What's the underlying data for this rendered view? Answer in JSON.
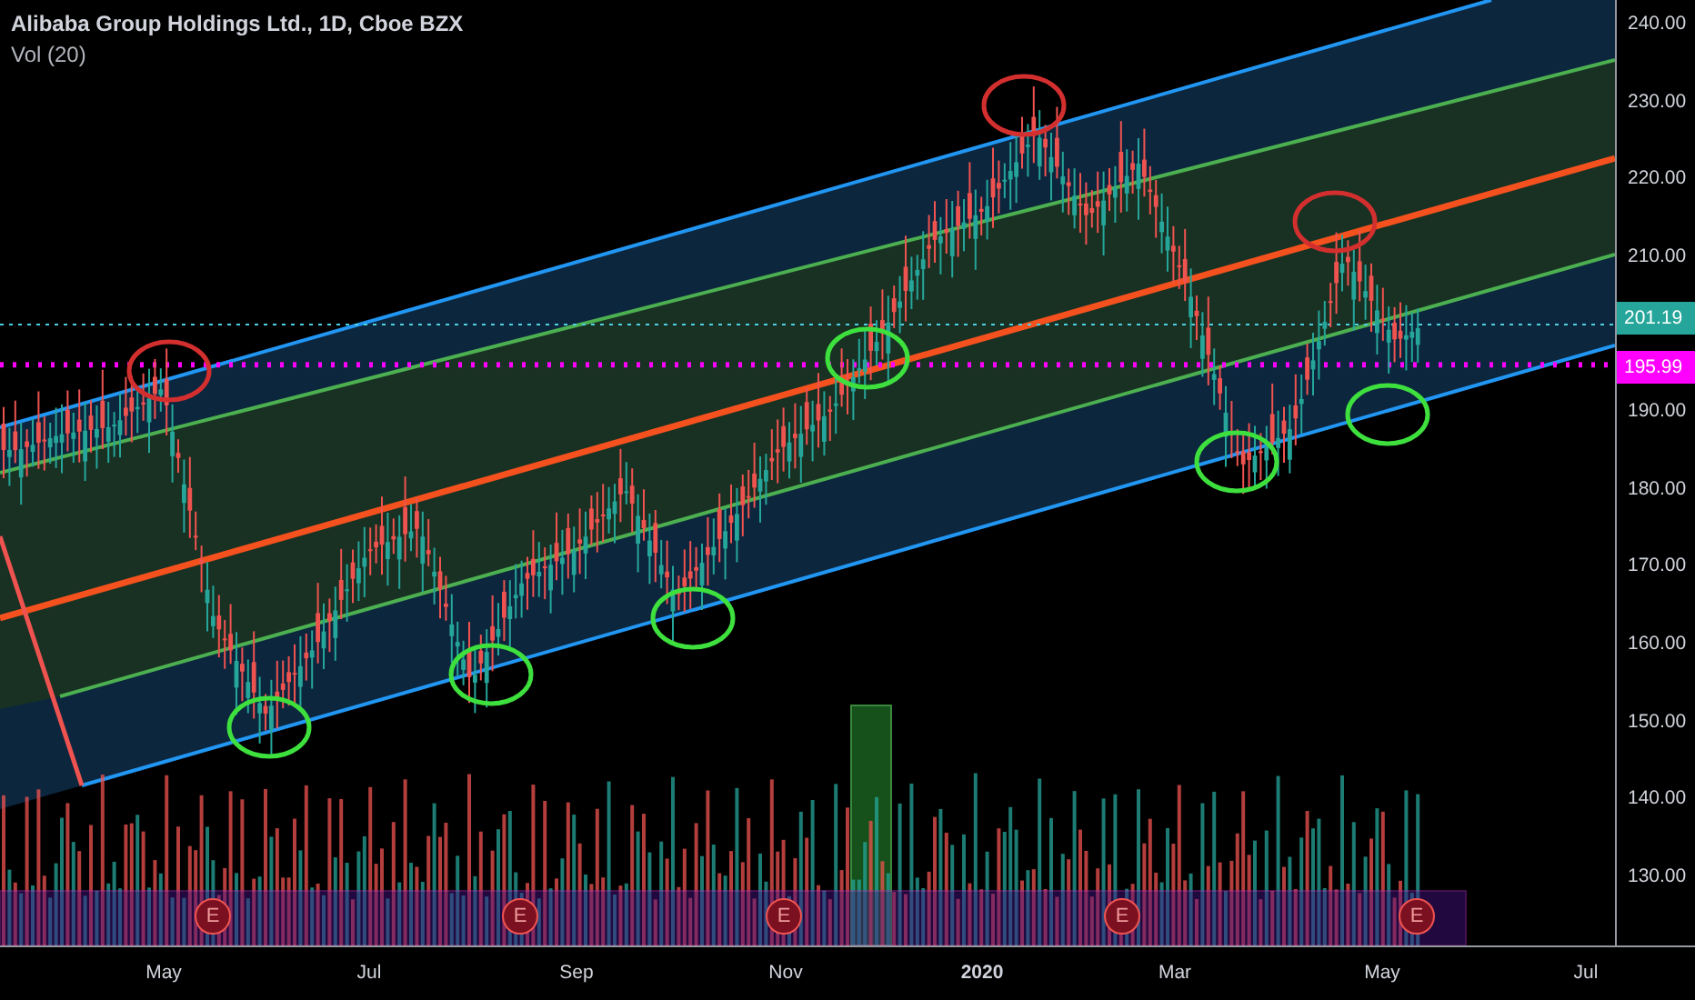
{
  "header": {
    "title": "Alibaba Group Holdings Ltd., 1D, Cboe BZX",
    "indicator": "Vol (20)"
  },
  "price_axis": [
    "240.00",
    "230.00",
    "220.00",
    "210.00",
    "190.00",
    "180.00",
    "170.00",
    "160.00",
    "150.00",
    "140.00",
    "130.00"
  ],
  "price_labels": [
    {
      "kind": "last",
      "text": "201.19"
    },
    {
      "kind": "level",
      "text": "195.99"
    }
  ],
  "time_axis": [
    {
      "kind": "month",
      "text": "May"
    },
    {
      "kind": "month",
      "text": "Jul"
    },
    {
      "kind": "month",
      "text": "Sep"
    },
    {
      "kind": "month",
      "text": "Nov"
    },
    {
      "kind": "year",
      "text": "2020"
    },
    {
      "kind": "month",
      "text": "Mar"
    },
    {
      "kind": "month",
      "text": "May"
    },
    {
      "kind": "month",
      "text": "Jul"
    }
  ],
  "earnings_markers": [
    "E",
    "E",
    "E",
    "E",
    "E"
  ]
}
